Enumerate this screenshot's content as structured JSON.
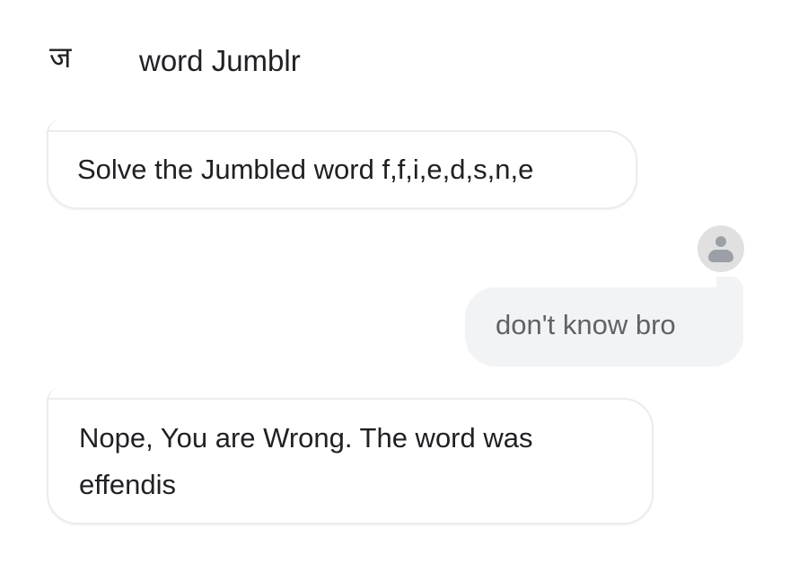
{
  "header": {
    "logo_glyph": "ज",
    "title": "word Jumblr"
  },
  "messages": [
    {
      "sender": "bot",
      "text": "Solve the Jumbled word f,f,i,e,d,s,n,e"
    },
    {
      "sender": "user",
      "text": "don't know bro"
    },
    {
      "sender": "bot",
      "text": "Nope, You are Wrong. The word was effendis"
    }
  ],
  "colors": {
    "user_bubble": "#f1f3f4",
    "bot_bubble_border": "#ececec",
    "avatar_bg": "#e0e0e0",
    "avatar_icon": "#9aa0a6"
  },
  "icons": {
    "user_avatar": "person-icon"
  }
}
